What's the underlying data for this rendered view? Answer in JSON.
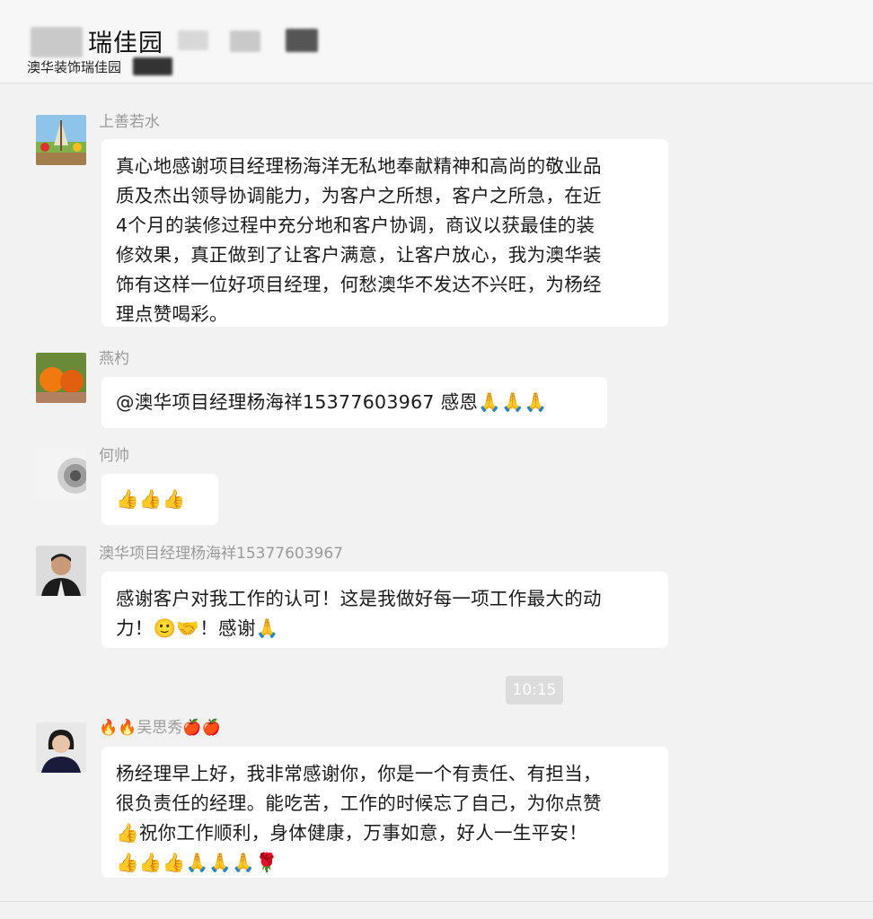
{
  "chat": {
    "title": "瑞佳园",
    "subtitle": "澳华装饰瑞佳园"
  },
  "messages": [
    {
      "sender": "上善若水",
      "lines": [
        "真心地感谢项目经理杨海洋无私地奉献精神和高尚的敬业品",
        "质及杰出领导协调能力，为客户之所想，客户之所急，在近",
        "4个月的装修过程中充分地和客户协调，商议以获最佳的装",
        "修效果，真正做到了让客户满意，让客户放心，我为澳华装",
        "饰有这样一位好项目经理，何愁澳华不发达不兴旺，为杨经",
        "理点赞喝彩。"
      ]
    },
    {
      "sender": "燕杓",
      "text": "@澳华项目经理杨海祥15377603967 感恩🙏🙏🙏"
    },
    {
      "sender": "何帅",
      "text": "👍👍👍"
    },
    {
      "sender": "澳华项目经理杨海祥15377603967",
      "lines": [
        "感谢客户对我工作的认可！这是我做好每一项工作最大的动",
        "力！🙂🤝！感谢🙏"
      ]
    },
    {
      "sender": "🔥🔥吴思秀🍎🍎",
      "lines": [
        "杨经理早上好，我非常感谢你，你是一个有责任、有担当，",
        "很负责任的经理。能吃苦，工作的时候忘了自己，为你点赞",
        "👍祝你工作顺利，身体健康，万事如意，好人一生平安！",
        "👍👍👍🙏🙏🙏🌹"
      ]
    }
  ],
  "timestamp": "10:15"
}
